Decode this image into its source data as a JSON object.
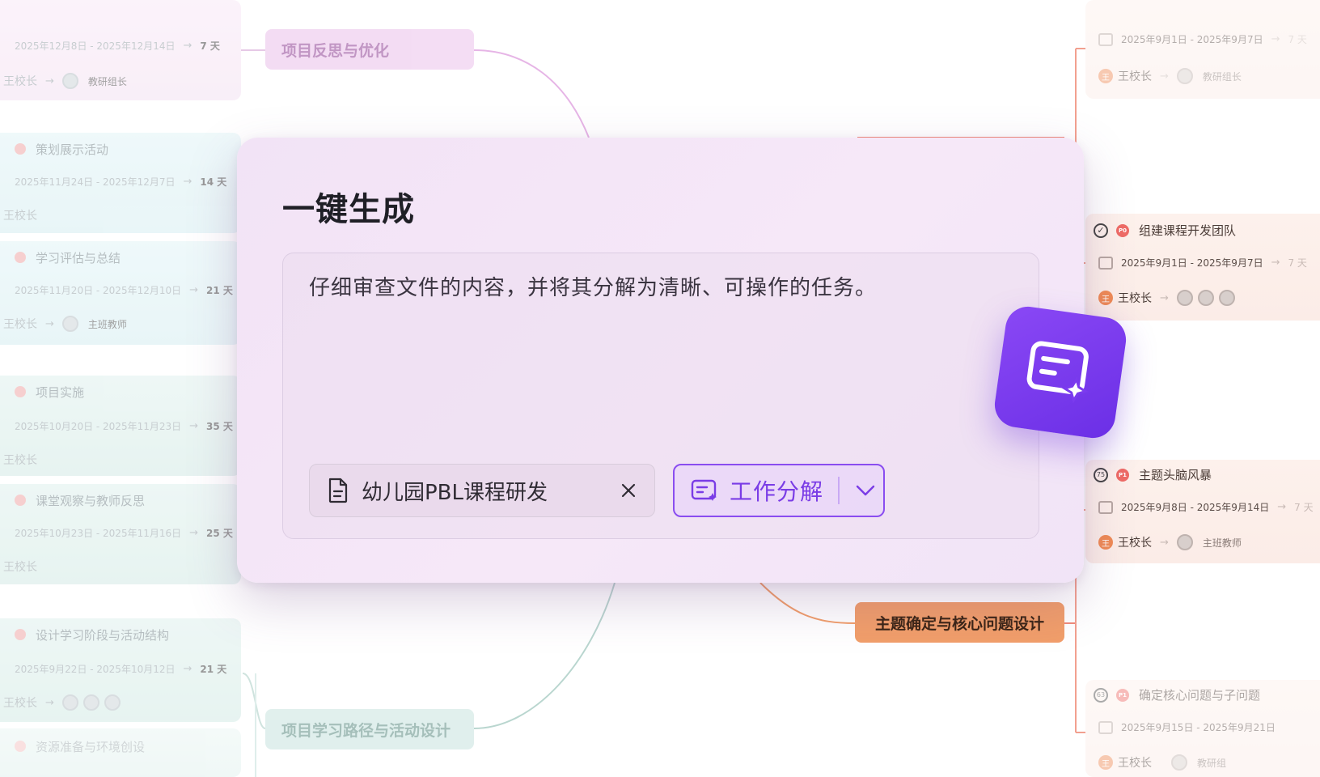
{
  "modal": {
    "title": "一键生成",
    "prompt": "仔细审查文件的内容，并将其分解为清晰、可操作的任务。",
    "file_chip": {
      "name": "幼儿园PBL课程研发",
      "icon": "document-icon",
      "remove_icon": "close-icon"
    },
    "mode_select": {
      "label": "工作分解",
      "icon": "task-breakdown-icon",
      "dropdown_icon": "chevron-down-icon"
    }
  },
  "fab": {
    "icon": "ai-task-sparkle-icon",
    "color": "#7b3bee"
  },
  "branches": {
    "reflect": "项目反思与优化",
    "path": "项目学习路径与活动设计",
    "theme": "主题确定与核心问题设计"
  },
  "left_cards": [
    {
      "title": "",
      "dates": "2025年12月8日 - 2025年12月14日",
      "arrow": "→",
      "duration": "7 天",
      "owner": "王校长",
      "assignee": "教研组长"
    },
    {
      "title": "策划展示活动",
      "dates": "2025年11月24日 - 2025年12月7日",
      "arrow": "→",
      "duration": "14 天",
      "owner": "王校长",
      "assignee": ""
    },
    {
      "title": "学习评估与总结",
      "dates": "2025年11月20日 - 2025年12月10日",
      "arrow": "→",
      "duration": "21 天",
      "owner": "王校长",
      "assignee": "主班教师"
    },
    {
      "title": "项目实施",
      "dates": "2025年10月20日 - 2025年11月23日",
      "arrow": "→",
      "duration": "35 天",
      "owner": "王校长",
      "assignee": ""
    },
    {
      "title": "课堂观察与教师反思",
      "dates": "2025年10月23日 - 2025年11月16日",
      "arrow": "→",
      "duration": "25 天",
      "owner": "王校长",
      "assignee": ""
    },
    {
      "title": "设计学习阶段与活动结构",
      "dates": "2025年9月22日 - 2025年10月12日",
      "arrow": "→",
      "duration": "21 天",
      "owner": "王校长",
      "assignee": ""
    },
    {
      "title": "资源准备与环境创设",
      "dates": "",
      "arrow": "",
      "duration": "",
      "owner": "",
      "assignee": ""
    }
  ],
  "right_cards": [
    {
      "title": "",
      "priority": "",
      "dates": "2025年9月1日 - 2025年9月7日",
      "arrow": "→",
      "duration": "7 天",
      "owner_badge": "王",
      "owner": "王校长",
      "assignee": "教研组长"
    },
    {
      "title": "组建课程开发团队",
      "priority": "P0",
      "dates": "2025年9月1日 - 2025年9月7日",
      "arrow": "→",
      "duration": "7 天",
      "owner_badge": "王",
      "owner": "王校长",
      "assignee": ""
    },
    {
      "title": "主题头脑风暴",
      "priority": "P1",
      "dates": "2025年9月8日 - 2025年9月14日",
      "arrow": "→",
      "duration": "7 天",
      "owner_badge": "王",
      "owner": "王校长",
      "assignee": "主班教师"
    },
    {
      "title": "确定核心问题与子问题",
      "priority": "P1",
      "dates": "2025年9月15日 - 2025年9月21日",
      "arrow": "",
      "duration": "",
      "owner_badge": "王",
      "owner": "王校长",
      "assignee": "教研组"
    }
  ],
  "colors": {
    "accent": "#7a3ce6",
    "theme_branch": "#f19e6a",
    "reflect_branch": "#f1d4f1",
    "path_branch": "#d9ece9",
    "priority_dot": "#ee6b66"
  }
}
